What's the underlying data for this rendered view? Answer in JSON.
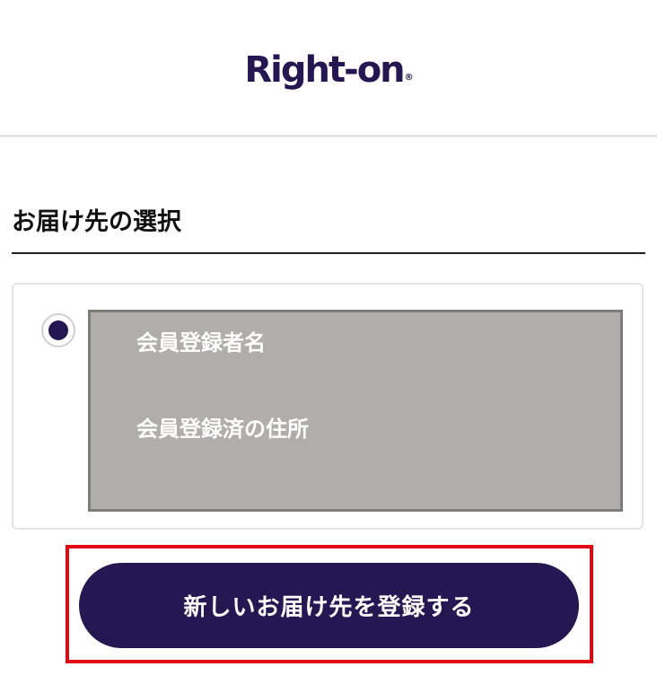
{
  "header": {
    "logo_text": "Right-on",
    "logo_mark": "®"
  },
  "section": {
    "title": "お届け先の選択"
  },
  "address_option": {
    "selected": true,
    "name": "会員登録者名",
    "address": "会員登録済の住所"
  },
  "actions": {
    "register_new_label": "新しいお届け先を登録する"
  },
  "colors": {
    "brand": "#251852",
    "highlight": "#e30613",
    "redaction": "#b0adac"
  }
}
